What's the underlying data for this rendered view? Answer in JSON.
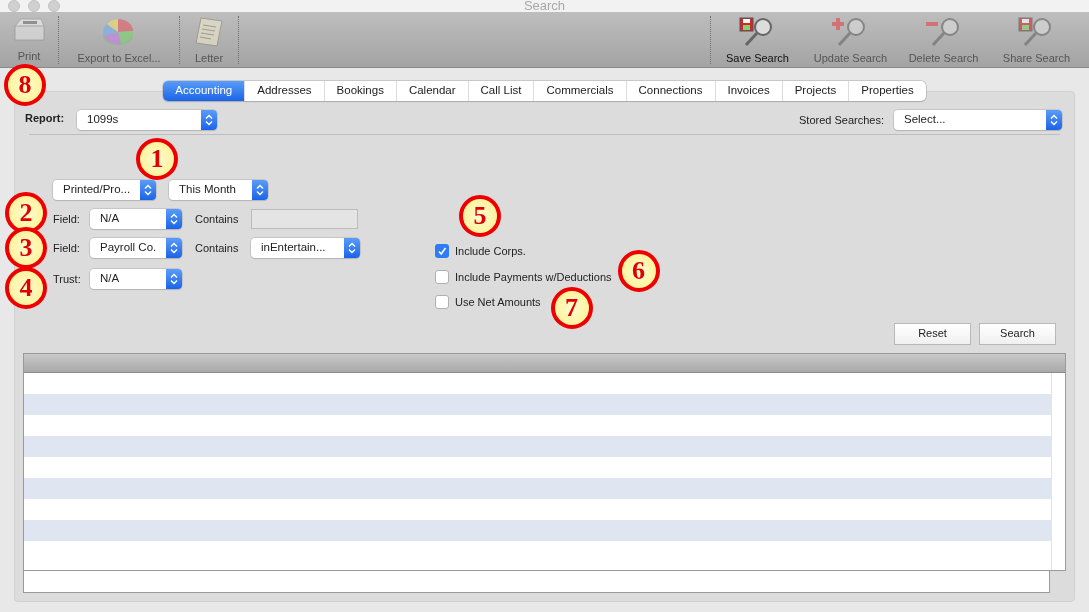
{
  "window": {
    "title": "Search"
  },
  "toolbar_left": [
    {
      "label": "Print",
      "kind": "printer",
      "disabled": true,
      "callout": "8"
    },
    {
      "label": "Export to Excel...",
      "kind": "chart",
      "disabled": true
    },
    {
      "label": "Letter",
      "kind": "letter",
      "disabled": true
    }
  ],
  "toolbar_right": [
    {
      "label": "Save Search",
      "kind": "save",
      "disabled": false
    },
    {
      "label": "Update Search",
      "kind": "add",
      "disabled": true
    },
    {
      "label": "Delete Search",
      "kind": "remove",
      "disabled": true
    },
    {
      "label": "Share Search",
      "kind": "save",
      "disabled": true
    }
  ],
  "tabs": [
    {
      "label": "Accounting",
      "selected": true
    },
    {
      "label": "Addresses",
      "selected": false
    },
    {
      "label": "Bookings",
      "selected": false
    },
    {
      "label": "Calendar",
      "selected": false
    },
    {
      "label": "Call List",
      "selected": false
    },
    {
      "label": "Commercials",
      "selected": false
    },
    {
      "label": "Connections",
      "selected": false
    },
    {
      "label": "Invoices",
      "selected": false
    },
    {
      "label": "Projects",
      "selected": false
    },
    {
      "label": "Properties",
      "selected": false
    }
  ],
  "report": {
    "label": "Report:",
    "value": "1099s"
  },
  "stored_searches": {
    "label": "Stored Searches:",
    "value": "Select..."
  },
  "period_row": {
    "status": "Printed/Pro...",
    "period": "This Month",
    "callout": "1"
  },
  "field_rows": [
    {
      "label": "Field:",
      "value": "N/A",
      "contains_label": "Contains",
      "contains": {
        "kind": "text"
      },
      "callout": "2"
    },
    {
      "label": "Field:",
      "value": "Payroll Co.",
      "contains_label": "Contains",
      "contains": {
        "kind": "select",
        "value": "inEntertain..."
      },
      "callout": "3"
    }
  ],
  "trust": {
    "label": "Trust:",
    "value": "N/A",
    "callout": "4"
  },
  "options": [
    {
      "label": "Include Corps.",
      "checked": true,
      "callout": "5"
    },
    {
      "label": "Include Payments w/Deductions",
      "checked": false,
      "callout": "6"
    },
    {
      "label": "Use Net Amounts",
      "checked": false,
      "callout": "7"
    }
  ],
  "buttons": [
    "Reset",
    "Search"
  ]
}
